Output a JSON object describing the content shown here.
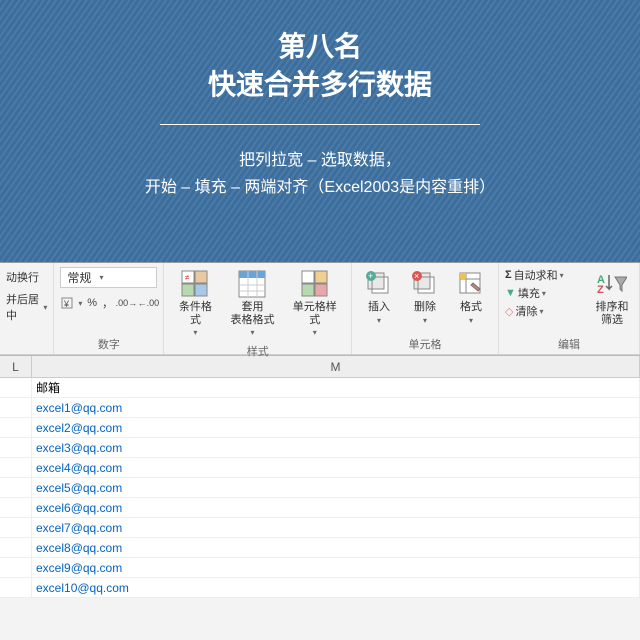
{
  "hero": {
    "title_l1": "第八名",
    "title_l2": "快速合并多行数据",
    "sub_l1": "把列拉宽 – 选取数据，",
    "sub_l2": "开始 – 填充 – 两端对齐（Excel2003是内容重排）"
  },
  "ribbon": {
    "wrap_l1": "动换行",
    "wrap_l2": "并后居中",
    "align_group": "",
    "number_combo": "常规",
    "number_group": "数字",
    "cond_fmt": "条件格式",
    "table_fmt_l1": "套用",
    "table_fmt_l2": "表格格式",
    "cell_style": "单元格样式",
    "styles_group": "样式",
    "insert": "插入",
    "delete": "删除",
    "format": "格式",
    "cells_group": "单元格",
    "autosum": "自动求和",
    "fill": "填充",
    "clear": "清除",
    "sort_filter": "排序和筛选",
    "editing_group": "编辑"
  },
  "columns": {
    "L": "L",
    "M": "M"
  },
  "sheet": {
    "header": "邮箱",
    "rows": [
      "excel1@qq.com",
      "excel2@qq.com",
      "excel3@qq.com",
      "excel4@qq.com",
      "excel5@qq.com",
      "excel6@qq.com",
      "excel7@qq.com",
      "excel8@qq.com",
      "excel9@qq.com",
      "excel10@qq.com"
    ]
  }
}
